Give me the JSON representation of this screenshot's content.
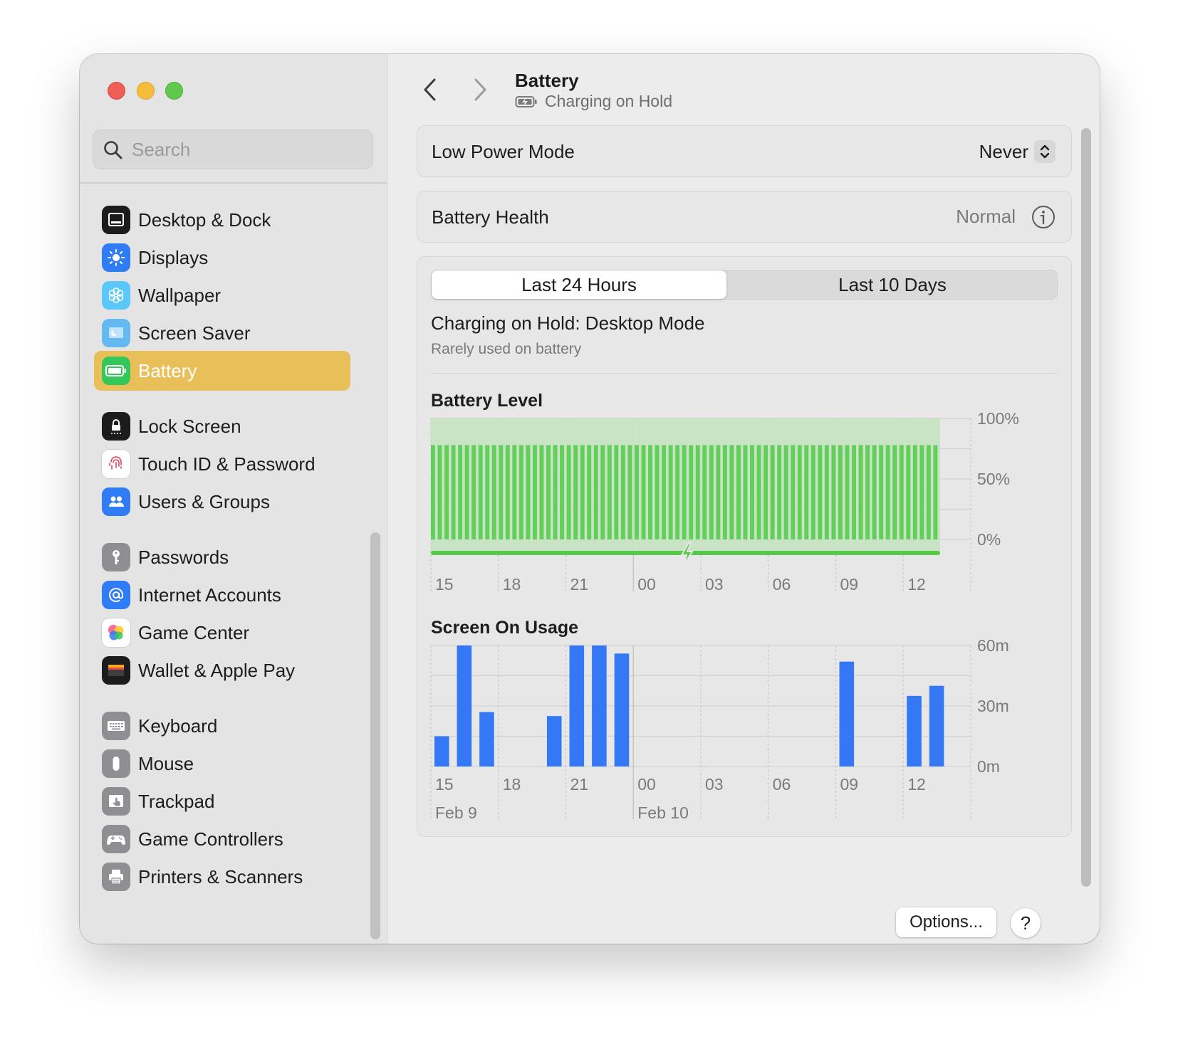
{
  "sidebar": {
    "search_placeholder": "Search",
    "items": [
      {
        "label": "Desktop & Dock",
        "icon": "desktop-dock-icon",
        "color": "#1c1c1e",
        "active": false
      },
      {
        "label": "Displays",
        "icon": "displays-icon",
        "color": "#2f7cf6",
        "active": false
      },
      {
        "label": "Wallpaper",
        "icon": "wallpaper-icon",
        "color": "#5ac8fa",
        "active": false
      },
      {
        "label": "Screen Saver",
        "icon": "screen-saver-icon",
        "color": "#64b9f0",
        "active": false
      },
      {
        "label": "Battery",
        "icon": "battery-icon",
        "color": "#34c759",
        "active": true
      },
      {
        "label": "Lock Screen",
        "icon": "lock-screen-icon",
        "color": "#1c1c1e",
        "active": false
      },
      {
        "label": "Touch ID & Password",
        "icon": "fingerprint-icon",
        "color": "#ffffff",
        "active": false
      },
      {
        "label": "Users & Groups",
        "icon": "users-groups-icon",
        "color": "#2f7cf6",
        "active": false
      },
      {
        "label": "Passwords",
        "icon": "key-icon",
        "color": "#8e8e93",
        "active": false
      },
      {
        "label": "Internet Accounts",
        "icon": "at-sign-icon",
        "color": "#2f7cf6",
        "active": false
      },
      {
        "label": "Game Center",
        "icon": "game-center-icon",
        "color": "#ffffff",
        "active": false
      },
      {
        "label": "Wallet & Apple Pay",
        "icon": "wallet-icon",
        "color": "#1c1c1e",
        "active": false
      },
      {
        "label": "Keyboard",
        "icon": "keyboard-icon",
        "color": "#8e8e93",
        "active": false
      },
      {
        "label": "Mouse",
        "icon": "mouse-icon",
        "color": "#8e8e93",
        "active": false
      },
      {
        "label": "Trackpad",
        "icon": "trackpad-icon",
        "color": "#8e8e93",
        "active": false
      },
      {
        "label": "Game Controllers",
        "icon": "game-controller-icon",
        "color": "#8e8e93",
        "active": false
      },
      {
        "label": "Printers & Scanners",
        "icon": "printer-icon",
        "color": "#8e8e93",
        "active": false
      }
    ]
  },
  "header": {
    "title": "Battery",
    "subtitle": "Charging on Hold",
    "subtitle_icon": "battery-charging-icon"
  },
  "low_power": {
    "label": "Low Power Mode",
    "value": "Never"
  },
  "health": {
    "label": "Battery Health",
    "value": "Normal"
  },
  "tabs": [
    {
      "label": "Last 24 Hours",
      "selected": true
    },
    {
      "label": "Last 10 Days",
      "selected": false
    }
  ],
  "mode": {
    "title": "Charging on Hold: Desktop Mode",
    "subtitle": "Rarely used on battery"
  },
  "buttons": {
    "options": "Options...",
    "help": "?"
  },
  "chart_data": [
    {
      "type": "bar",
      "title": "Battery Level",
      "x_tick_labels": [
        "15",
        "18",
        "21",
        "00",
        "03",
        "06",
        "09",
        "12"
      ],
      "y_tick_labels": [
        "100%",
        "50%",
        "0%"
      ],
      "ylim": [
        0,
        100
      ],
      "bar_count": 75,
      "value": 78,
      "charging": true,
      "colors": {
        "bars": "#62cf5a",
        "background": "#c5e3c0",
        "charging_line": "#58c84c"
      }
    },
    {
      "type": "bar",
      "title": "Screen On Usage",
      "unit": "minutes",
      "x_tick_labels": [
        "15",
        "18",
        "21",
        "00",
        "03",
        "06",
        "09",
        "12"
      ],
      "date_labels": [
        "Feb 9",
        "Feb 10"
      ],
      "y_tick_labels": [
        "60m",
        "30m",
        "0m"
      ],
      "ylim": [
        0,
        60
      ],
      "slot_hours": [
        "15",
        "16",
        "17",
        "18",
        "19",
        "20",
        "21",
        "22",
        "23",
        "00",
        "01",
        "02",
        "03",
        "04",
        "05",
        "06",
        "07",
        "08",
        "09",
        "10",
        "11",
        "12",
        "13",
        "14"
      ],
      "values": [
        15,
        60,
        27,
        0,
        0,
        25,
        60,
        60,
        56,
        0,
        0,
        0,
        0,
        0,
        0,
        0,
        0,
        0,
        52,
        0,
        0,
        35,
        40,
        0
      ],
      "colors": {
        "bars": "#3478f6"
      }
    }
  ]
}
